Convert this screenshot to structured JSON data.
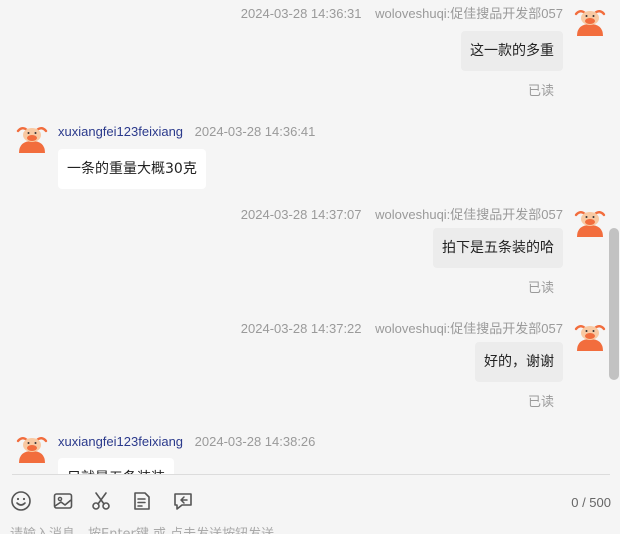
{
  "messages": [
    {
      "side": "right",
      "name": "woloveshuqi:促佳搜品开发部057",
      "time": "2024-03-28 14:36:31",
      "text": "这一款的多重",
      "status": "已读",
      "avatar": "bull-avatar-icon"
    },
    {
      "side": "left",
      "name": "xuxiangfei123feixiang",
      "time": "2024-03-28 14:36:41",
      "text": "一条的重量大概30克",
      "avatar": "bull-avatar-icon"
    },
    {
      "side": "right",
      "name": "woloveshuqi:促佳搜品开发部057",
      "time": "2024-03-28 14:37:07",
      "text": "拍下是五条装的哈",
      "status": "已读",
      "avatar": "bull-avatar-icon"
    },
    {
      "side": "right",
      "name": "woloveshuqi:促佳搜品开发部057",
      "time": "2024-03-28 14:37:22",
      "text": "好的，谢谢",
      "status": "已读",
      "avatar": "bull-avatar-icon"
    },
    {
      "side": "left",
      "name": "xuxiangfei123feixiang",
      "time": "2024-03-28 14:38:26",
      "text": "只就是五条装装",
      "avatar": "bull-avatar-icon"
    }
  ],
  "toolbar": {
    "icons": [
      "emoji-icon",
      "image-icon",
      "scissors-icon",
      "document-icon",
      "quick-reply-icon"
    ],
    "counter": "0 / 500"
  },
  "input": {
    "placeholder": "请输入消息，按Enter键 或 点击发送按钮发送"
  },
  "colors": {
    "background": "#f5f5f5",
    "self_bubble": "#ececec",
    "other_bubble": "#ffffff",
    "left_name": "#2b3a8c",
    "avatar_orange": "#f26d3d"
  }
}
